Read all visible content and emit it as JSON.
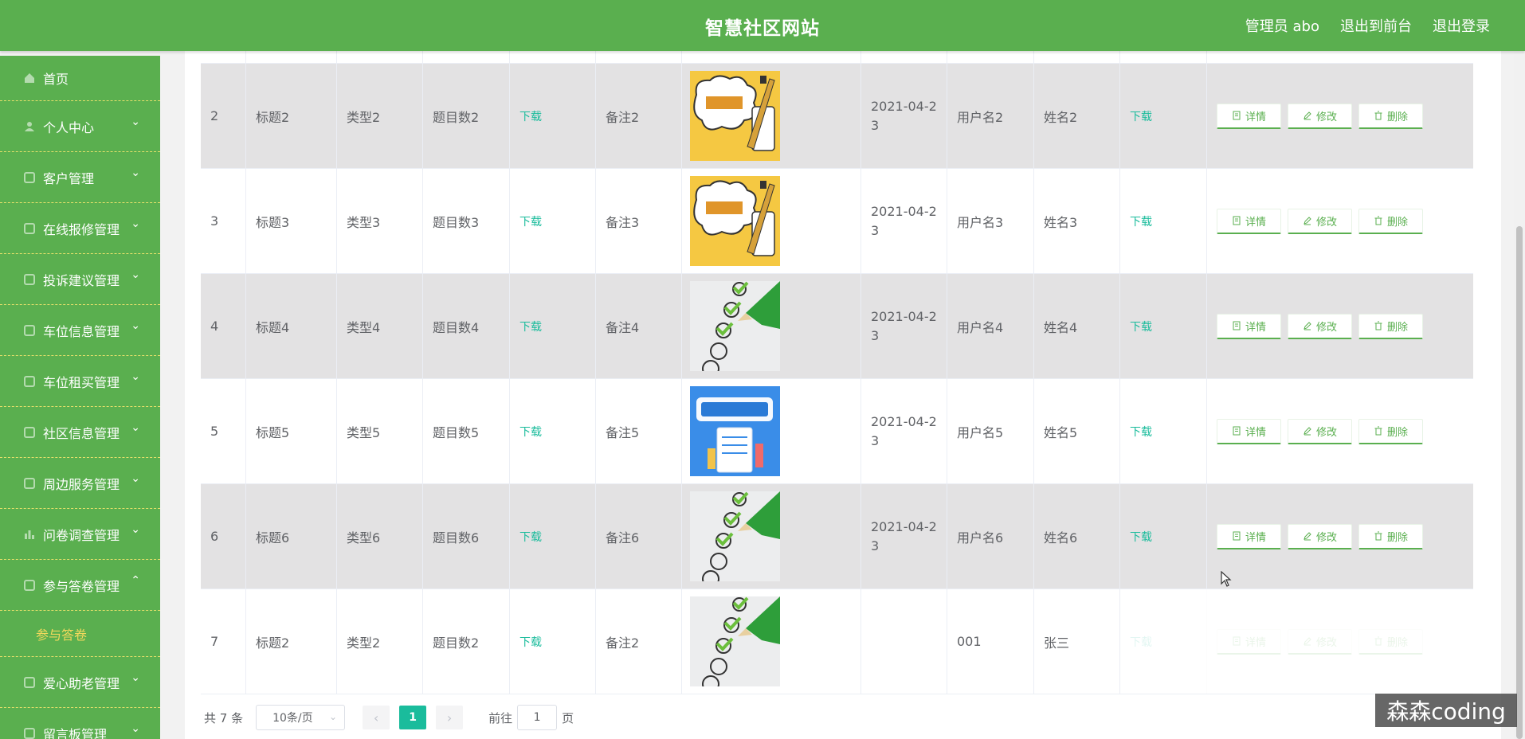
{
  "header": {
    "title": "智慧社区网站",
    "admin": "管理员 abo",
    "front": "退出到前台",
    "logout": "退出登录"
  },
  "sidebar": {
    "items": [
      {
        "label": "首页",
        "icon": "home-icon",
        "chevron": ""
      },
      {
        "label": "个人中心",
        "icon": "user-icon",
        "chevron": "down"
      },
      {
        "label": "客户管理",
        "icon": "customer-icon",
        "chevron": "down"
      },
      {
        "label": "在线报修管理",
        "icon": "repair-icon",
        "chevron": "down"
      },
      {
        "label": "投诉建议管理",
        "icon": "complaint-icon",
        "chevron": "down"
      },
      {
        "label": "车位信息管理",
        "icon": "parking-icon",
        "chevron": "down"
      },
      {
        "label": "车位租买管理",
        "icon": "car-icon",
        "chevron": "down"
      },
      {
        "label": "社区信息管理",
        "icon": "info-icon",
        "chevron": "down"
      },
      {
        "label": "周边服务管理",
        "icon": "service-icon",
        "chevron": "down"
      },
      {
        "label": "问卷调查管理",
        "icon": "chart-icon",
        "chevron": "down"
      },
      {
        "label": "参与答卷管理",
        "icon": "answer-icon",
        "chevron": "up"
      },
      {
        "label": "爱心助老管理",
        "icon": "heart-icon",
        "chevron": "down"
      },
      {
        "label": "留言板管理",
        "icon": "message-icon",
        "chevron": "down"
      }
    ],
    "active_sub": "参与答卷"
  },
  "table": {
    "download_label": "下载",
    "buttons": {
      "detail": "详情",
      "edit": "修改",
      "delete": "删除"
    },
    "rows": [
      {
        "id": "2",
        "title": "标题2",
        "type": "类型2",
        "count": "题目数2",
        "remark": "备注2",
        "image": "survey-cartoon",
        "date": "2021-04-23",
        "date_a": "2021-04-2",
        "date_b": "3",
        "user": "用户名2",
        "name": "姓名2"
      },
      {
        "id": "3",
        "title": "标题3",
        "type": "类型3",
        "count": "题目数3",
        "remark": "备注3",
        "image": "survey-cartoon",
        "date": "2021-04-23",
        "date_a": "2021-04-2",
        "date_b": "3",
        "user": "用户名3",
        "name": "姓名3"
      },
      {
        "id": "4",
        "title": "标题4",
        "type": "类型4",
        "count": "题目数4",
        "remark": "备注4",
        "image": "checklist-pencil",
        "date": "2021-04-23",
        "date_a": "2021-04-2",
        "date_b": "3",
        "user": "用户名4",
        "name": "姓名4"
      },
      {
        "id": "5",
        "title": "标题5",
        "type": "类型5",
        "count": "题目数5",
        "remark": "备注5",
        "image": "survey-blue",
        "date": "2021-04-23",
        "date_a": "2021-04-2",
        "date_b": "3",
        "user": "用户名5",
        "name": "姓名5"
      },
      {
        "id": "6",
        "title": "标题6",
        "type": "类型6",
        "count": "题目数6",
        "remark": "备注6",
        "image": "checklist-pencil",
        "date": "2021-04-23",
        "date_a": "2021-04-2",
        "date_b": "3",
        "user": "用户名6",
        "name": "姓名6"
      },
      {
        "id": "7",
        "title": "标题2",
        "type": "类型2",
        "count": "题目数2",
        "remark": "备注2",
        "image": "checklist-pencil",
        "date": "",
        "date_a": "",
        "date_b": "",
        "user": "001",
        "name": "张三"
      }
    ]
  },
  "pagination": {
    "total": "共 7 条",
    "page_size": "10条/页",
    "current": "1",
    "goto_prefix": "前往",
    "goto_value": "1",
    "goto_suffix": "页"
  },
  "watermark": "森森coding",
  "colors": {
    "primary": "#5aaf4f",
    "accent": "#1abc9c",
    "submenu_active": "#f3d95c"
  }
}
